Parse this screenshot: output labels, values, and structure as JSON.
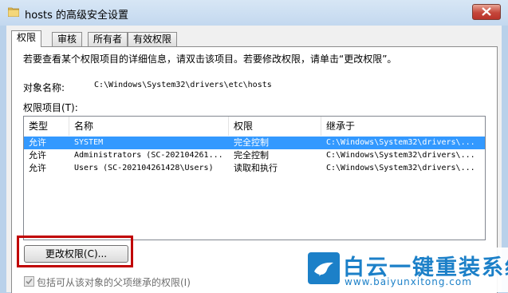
{
  "window": {
    "title": "hosts 的高级安全设置",
    "icon": "folder-icon"
  },
  "tabs": [
    "权限",
    "审核",
    "所有者",
    "有效权限"
  ],
  "info_text": "若要查看某个权限项目的详细信息，请双击该项目。若要修改权限，请单击“更改权限”。",
  "object": {
    "label": "对象名称:",
    "path": "C:\\Windows\\System32\\drivers\\etc\\hosts"
  },
  "permissions_label": "权限项目(T):",
  "columns": [
    "类型",
    "名称",
    "权限",
    "继承于"
  ],
  "rows": [
    {
      "type": "允许",
      "name": "SYSTEM",
      "perm": "完全控制",
      "inherit": "C:\\Windows\\System32\\drivers\\..."
    },
    {
      "type": "允许",
      "name": "Administrators (SC-202104261...",
      "perm": "完全控制",
      "inherit": "C:\\Windows\\System32\\drivers\\..."
    },
    {
      "type": "允许",
      "name": "Users (SC-202104261428\\Users)",
      "perm": "读取和执行",
      "inherit": "C:\\Windows\\System32\\drivers\\..."
    }
  ],
  "change_button": "更改权限(C)...",
  "inherit_checkbox": {
    "label": "包括可从该对象的父项继承的权限(I)",
    "checked": true
  },
  "watermark": {
    "name": "白云一键重装系统",
    "url": "www.baiyunxitong.com",
    "icon": "bird-logo-icon"
  },
  "colors": {
    "selection": "#3399ff",
    "highlight_border": "#c00000",
    "watermark": "#1c80c8"
  }
}
